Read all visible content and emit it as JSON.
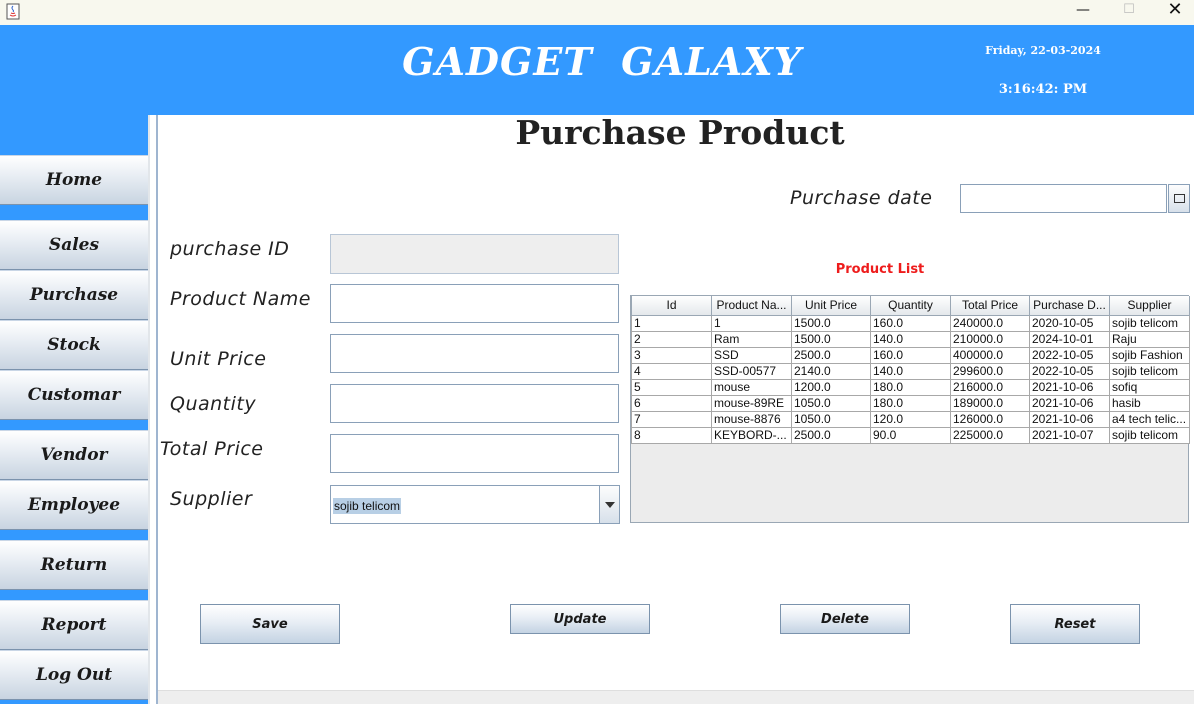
{
  "window": {
    "min_glyph": "—",
    "max_glyph": "☐",
    "close_glyph": "✕"
  },
  "header": {
    "brand": "GADGET  GALAXY",
    "date": "Friday, 22-03-2024",
    "time": "3:16:42: PM"
  },
  "sidebar": {
    "items": [
      {
        "label": "Home"
      },
      {
        "label": "Sales"
      },
      {
        "label": "Purchase"
      },
      {
        "label": "Stock"
      },
      {
        "label": "Customar"
      },
      {
        "label": "Vendor"
      },
      {
        "label": "Employee"
      },
      {
        "label": "Return"
      },
      {
        "label": "Report"
      },
      {
        "label": "Log Out"
      }
    ]
  },
  "page": {
    "title": "Purchase Product"
  },
  "form": {
    "purchase_date_label": "Purchase date",
    "purchase_date_value": "",
    "purchase_id_label": "purchase ID",
    "purchase_id_value": "",
    "product_name_label": "Product Name",
    "product_name_value": "",
    "unit_price_label": "Unit Price",
    "unit_price_value": "",
    "quantity_label": "Quantity",
    "quantity_value": "",
    "total_price_label": "Total Price",
    "total_price_value": "",
    "supplier_label": "Supplier",
    "supplier_value": "sojib telicom"
  },
  "product_list": {
    "title": "Product List",
    "columns": [
      "Id",
      "Product Na...",
      "Unit Price",
      "Quantity",
      "Total Price",
      "Purchase D...",
      "Supplier"
    ],
    "rows": [
      [
        "1",
        "1",
        "1500.0",
        "160.0",
        "240000.0",
        "2020-10-05",
        "sojib telicom"
      ],
      [
        "2",
        "Ram",
        "1500.0",
        "140.0",
        "210000.0",
        "2024-10-01",
        "Raju"
      ],
      [
        "3",
        "SSD",
        "2500.0",
        "160.0",
        "400000.0",
        "2022-10-05",
        "sojib Fashion"
      ],
      [
        "4",
        "SSD-00577",
        "2140.0",
        "140.0",
        "299600.0",
        "2022-10-05",
        "sojib telicom"
      ],
      [
        "5",
        "mouse",
        "1200.0",
        "180.0",
        "216000.0",
        "2021-10-06",
        "sofiq"
      ],
      [
        "6",
        "mouse-89RE",
        "1050.0",
        "180.0",
        "189000.0",
        "2021-10-06",
        "hasib"
      ],
      [
        "7",
        "mouse-8876",
        "1050.0",
        "120.0",
        "126000.0",
        "2021-10-06",
        "a4 tech telic..."
      ],
      [
        "8",
        "KEYBORD-...",
        "2500.0",
        "90.0",
        "225000.0",
        "2021-10-07",
        "sojib telicom"
      ]
    ]
  },
  "actions": {
    "save": "Save",
    "update": "Update",
    "delete": "Delete",
    "reset": "Reset"
  },
  "colors": {
    "header_bg": "#3399ff",
    "list_title": "#ee1c1c"
  }
}
